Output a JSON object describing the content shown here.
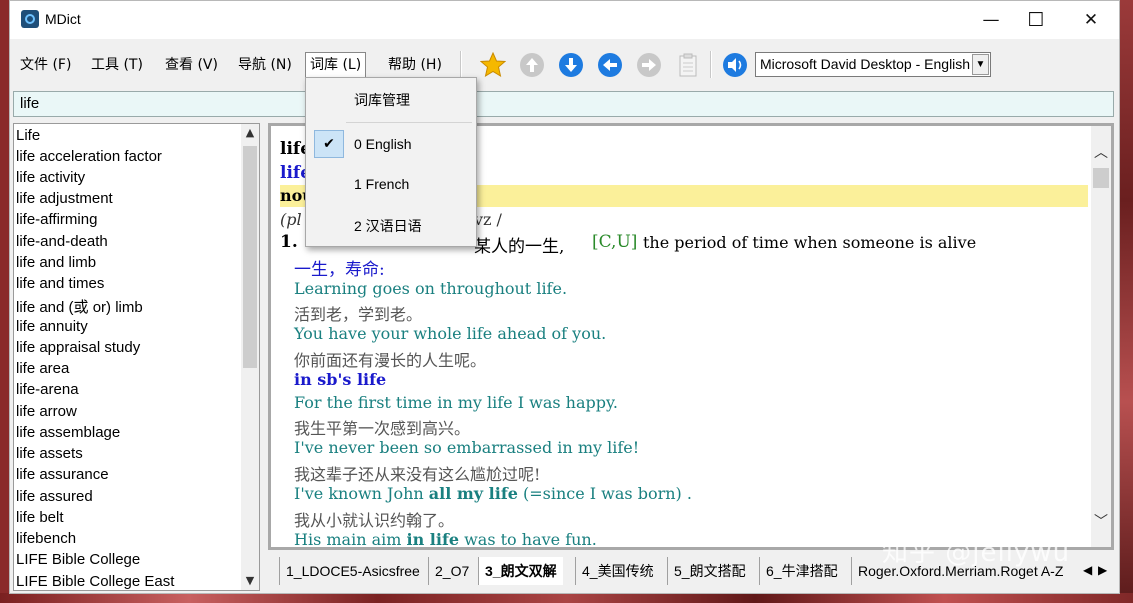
{
  "window": {
    "title": "MDict",
    "minimize": "—",
    "maximize": "☐",
    "close": "✕"
  },
  "menu": [
    {
      "label": "文件 (F)"
    },
    {
      "label": "工具 (T)"
    },
    {
      "label": "查看 (V)"
    },
    {
      "label": "导航 (N)"
    },
    {
      "label": "词库 (L)"
    },
    {
      "label": "帮助 (H)"
    }
  ],
  "toolbar": {
    "voice": "Microsoft David Desktop - English"
  },
  "search": {
    "value": "life"
  },
  "wordlist": [
    "Life",
    "life acceleration factor",
    "life activity",
    "life adjustment",
    "life-affirming",
    "life-and-death",
    "life and limb",
    "life and times",
    "life and (或 or) limb",
    "life annuity",
    "life appraisal study",
    "life area",
    "life-arena",
    "life arrow",
    "life assemblage",
    "life assets",
    "life assurance",
    "life assured",
    "life belt",
    "lifebench",
    "LIFE Bible College",
    "LIFE Bible College East"
  ],
  "entry": {
    "headword": "life",
    "headword2": "life",
    "pos": "noun",
    "plural_prefix": "(pl",
    "phon_suffix": "vz /",
    "sense_num": "1.",
    "sense_cn_tail": "某人的一生,",
    "grammar": "[C,U]",
    "definition": "the period of time when someone is alive",
    "cn_def": "一生，寿命:",
    "examples": [
      {
        "en": "Learning goes on throughout life.",
        "cn": "活到老，学到老。"
      },
      {
        "en": "You have your whole life ahead of you.",
        "cn": "你前面还有漫长的人生呢。"
      }
    ],
    "phrase": "in sb's life",
    "examples2": [
      {
        "en": "For the first time in my life I was happy.",
        "cn": "我生平第一次感到高兴。"
      },
      {
        "en": "I've never been so embarrassed in my life!",
        "cn": "我这辈子还从来没有这么尴尬过呢!"
      }
    ],
    "ex5_pre": "I've known John ",
    "ex5_bold": "all my life",
    "ex5_post": " (=since I was born) .",
    "ex5_cn": "我从小就认识约翰了。",
    "ex6_pre": "His main aim ",
    "ex6_bold": "in life",
    "ex6_post": " was to have fun."
  },
  "tabs": [
    {
      "label": "1_LDOCE5-Asicsfree"
    },
    {
      "label": "2_O7"
    },
    {
      "label": "3_朗文双解"
    },
    {
      "label": "4_美国传统"
    },
    {
      "label": "5_朗文搭配"
    },
    {
      "label": "6_牛津搭配"
    },
    {
      "label": "Roger.Oxford.Merriam.Roget A-Z"
    }
  ],
  "dropdown": {
    "manage": "词库管理",
    "items": [
      {
        "label": "0 English",
        "checked": true
      },
      {
        "label": "1 French",
        "checked": false
      },
      {
        "label": "2 汉语日语",
        "checked": false
      }
    ]
  },
  "watermark": "知乎 @jellywu",
  "colors": {
    "highlight": "#fbf09a",
    "blue": "#1a1acc",
    "teal": "#1a8080",
    "green": "#2a8a2a"
  }
}
